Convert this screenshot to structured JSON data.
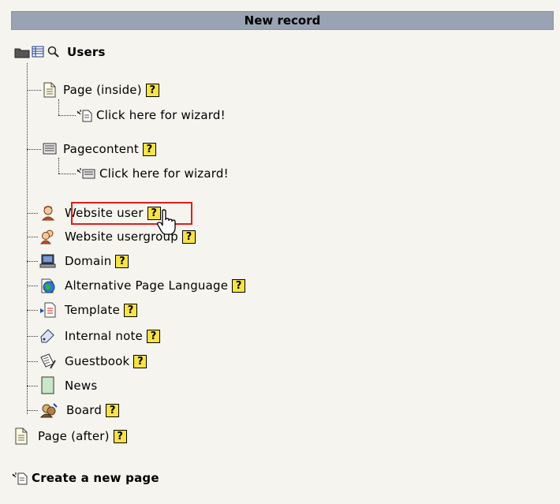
{
  "header": {
    "title": "New record"
  },
  "root": {
    "label": "Users"
  },
  "inside": {
    "page_label": "Page (inside)",
    "page_wizard": "Click here for wizard!",
    "content_label": "Pagecontent",
    "content_wizard": "Click here for wizard!"
  },
  "records": [
    {
      "label": "Website user",
      "icon": "website-user-icon",
      "help": true
    },
    {
      "label": "Website usergroup",
      "icon": "website-usergroup-icon",
      "help": true
    },
    {
      "label": "Domain",
      "icon": "domain-icon",
      "help": true
    },
    {
      "label": "Alternative Page Language",
      "icon": "globe-icon",
      "help": true
    },
    {
      "label": "Template",
      "icon": "template-icon",
      "help": true
    },
    {
      "label": "Internal note",
      "icon": "note-tag-icon",
      "help": true
    },
    {
      "label": "Guestbook",
      "icon": "guestbook-icon",
      "help": true
    },
    {
      "label": "News",
      "icon": "news-icon",
      "help": false
    },
    {
      "label": "Board",
      "icon": "board-icon",
      "help": true
    }
  ],
  "after": {
    "label": "Page (after)"
  },
  "create_page": {
    "label": "Create a new page"
  },
  "help_glyph": "?"
}
